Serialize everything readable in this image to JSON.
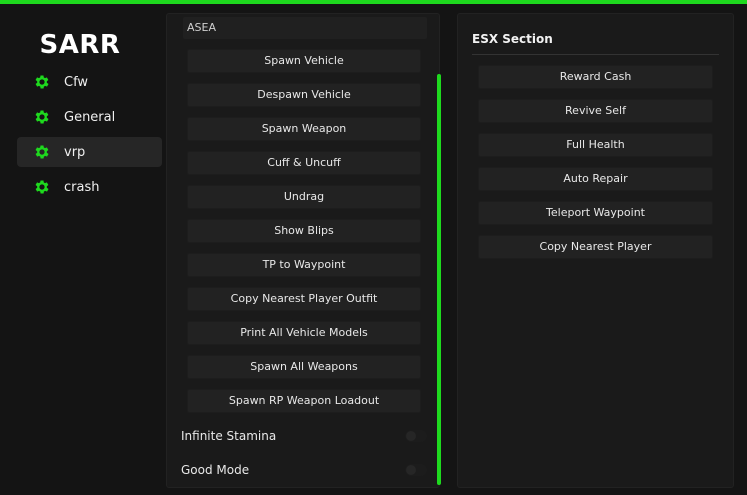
{
  "app": {
    "title": "SARR",
    "accent": "#1ed91e"
  },
  "sidebar": {
    "items": [
      {
        "label": "Cfw",
        "icon": "gear-icon",
        "active": false
      },
      {
        "label": "General",
        "icon": "gear-icon",
        "active": false
      },
      {
        "label": "vrp",
        "icon": "gear-icon",
        "active": true
      },
      {
        "label": "crash",
        "icon": "gear-icon",
        "active": false
      }
    ]
  },
  "main": {
    "section_title": "ASEA",
    "buttons": [
      "Spawn Vehicle",
      "Despawn Vehicle",
      "Spawn Weapon",
      "Cuff & Uncuff",
      "Undrag",
      "Show Blips",
      "TP to Waypoint",
      "Copy Nearest Player Outfit",
      "Print All Vehicle Models",
      "Spawn All Weapons",
      "Spawn RP Weapon Loadout"
    ],
    "toggles": [
      {
        "label": "Infinite Stamina",
        "on": false
      },
      {
        "label": "Good Mode",
        "on": false
      }
    ]
  },
  "esx": {
    "title": "ESX Section",
    "buttons": [
      "Reward Cash",
      "Revive Self",
      "Full Health",
      "Auto Repair",
      "Teleport Waypoint",
      "Copy Nearest Player"
    ]
  }
}
